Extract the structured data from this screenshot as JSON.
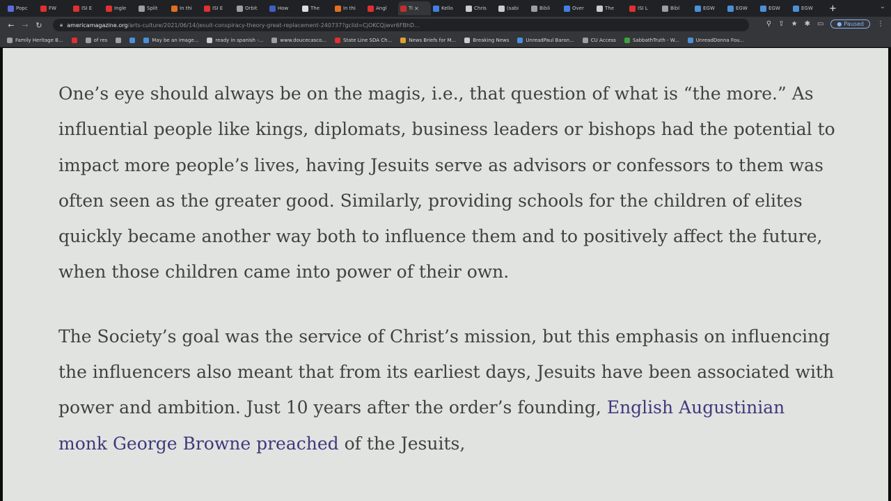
{
  "browser": {
    "tabs": [
      {
        "label": "Popc",
        "color": "#5b6be0"
      },
      {
        "label": "FW",
        "color": "#e03030"
      },
      {
        "label": "ISI E",
        "color": "#e03030"
      },
      {
        "label": "Ingle",
        "color": "#e03030"
      },
      {
        "label": "Split",
        "color": "#9aa0a6"
      },
      {
        "label": "In thi",
        "color": "#e07020"
      },
      {
        "label": "ISI E",
        "color": "#e03030"
      },
      {
        "label": "Orbit",
        "color": "#9aa0a6"
      },
      {
        "label": "How",
        "color": "#4060c0"
      },
      {
        "label": "The",
        "color": "#dddddd"
      },
      {
        "label": "In thi",
        "color": "#e07020"
      },
      {
        "label": "Angl",
        "color": "#e03030"
      },
      {
        "label": "Ti",
        "color": "#c03030"
      },
      {
        "label": "Kello",
        "color": "#4080e0"
      },
      {
        "label": "Chris",
        "color": "#cccccc"
      },
      {
        "label": "(sabi",
        "color": "#cccccc"
      },
      {
        "label": "Bibli",
        "color": "#9aa0a6"
      },
      {
        "label": "Over",
        "color": "#4080e0"
      },
      {
        "label": "The",
        "color": "#cccccc"
      },
      {
        "label": "ISI L",
        "color": "#e03030"
      },
      {
        "label": "Bibl",
        "color": "#9aa0a6"
      },
      {
        "label": "EGW",
        "color": "#4a90d9"
      },
      {
        "label": "EGW",
        "color": "#4a90d9"
      },
      {
        "label": "EGW",
        "color": "#4a90d9"
      },
      {
        "label": "EGW",
        "color": "#4a90d9"
      }
    ],
    "active_tab_index": 12,
    "address": {
      "host": "americamagazine.org",
      "path": "/arts-culture/2021/06/14/jesuit-conspiracy-theory-great-replacement-240737?gclid=CjOKCQjwvr6FBhD..."
    },
    "paused_label": "Paused",
    "bookmarks": [
      {
        "label": "Family Heritage B...",
        "color": "#9aa0a6"
      },
      {
        "label": "",
        "color": "#e03030"
      },
      {
        "label": "of res",
        "color": "#9aa0a6"
      },
      {
        "label": "",
        "color": "#9aa0a6"
      },
      {
        "label": "",
        "color": "#4a90d9"
      },
      {
        "label": "May be an image...",
        "color": "#4a90d9"
      },
      {
        "label": "ready in spanish -...",
        "color": "#cccccc"
      },
      {
        "label": "www.doucecasco...",
        "color": "#9aa0a6"
      },
      {
        "label": "State Line SDA Ch...",
        "color": "#e03030"
      },
      {
        "label": "News Briefs for M...",
        "color": "#e0a030"
      },
      {
        "label": "Breaking News",
        "color": "#cccccc"
      },
      {
        "label": "UnreadPaul Baron...",
        "color": "#4a90d9"
      },
      {
        "label": "CU Access",
        "color": "#9aa0a6"
      },
      {
        "label": "SabbathTruth - W...",
        "color": "#40a040"
      },
      {
        "label": "UnreadDonna Fou...",
        "color": "#4a90d9"
      }
    ]
  },
  "article": {
    "paragraph1": "One’s eye should always be on the magis, i.e., that question of what is “the more.” As influential people like kings, diplomats, business leaders or bishops had the potential to impact more people’s lives, having Jesuits serve as advisors or confessors to them was often seen as the greater good. Similarly, providing schools for the children of elites quickly became another way both to influence them and to positively affect the future, when those children came into power of their own.",
    "paragraph2_text": "The Society’s goal was the service of Christ’s mission, but this emphasis on influencing the influencers also meant that from its earliest days, Jesuits have been associated with power and ambition. Just 10 years after the order’s founding, ",
    "paragraph2_link": "English Augustinian monk George Browne preached",
    "paragraph2_tail": " of the Jesuits,"
  }
}
